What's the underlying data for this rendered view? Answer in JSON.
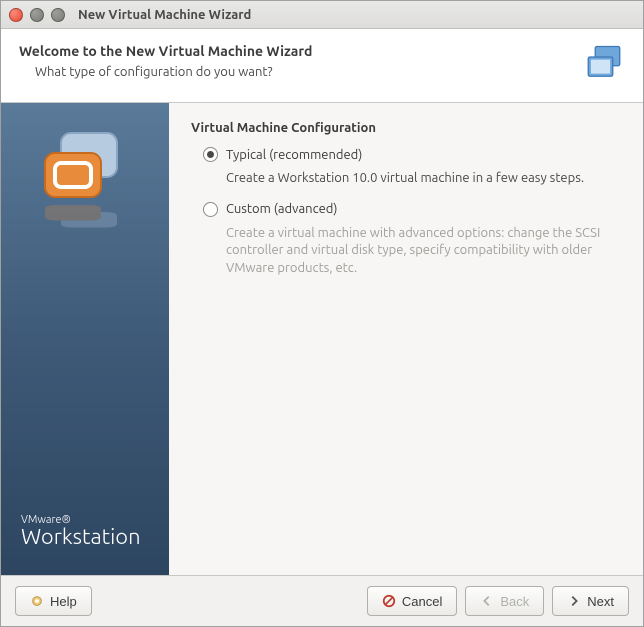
{
  "window": {
    "title": "New Virtual Machine Wizard"
  },
  "header": {
    "title": "Welcome to the New Virtual Machine Wizard",
    "subtitle": "What type of configuration do you want?"
  },
  "brand": {
    "small": "VMware®",
    "big": "Workstation"
  },
  "content": {
    "section_title": "Virtual Machine Configuration",
    "options": [
      {
        "label": "Typical (recommended)",
        "description": "Create a Workstation 10.0 virtual machine in a few easy steps.",
        "selected": true
      },
      {
        "label": "Custom (advanced)",
        "description": "Create a virtual machine with advanced options: change the SCSI controller and virtual disk type, specify compatibility with older VMware products, etc.",
        "selected": false
      }
    ]
  },
  "footer": {
    "help": "Help",
    "cancel": "Cancel",
    "back": "Back",
    "next": "Next",
    "back_enabled": false
  }
}
